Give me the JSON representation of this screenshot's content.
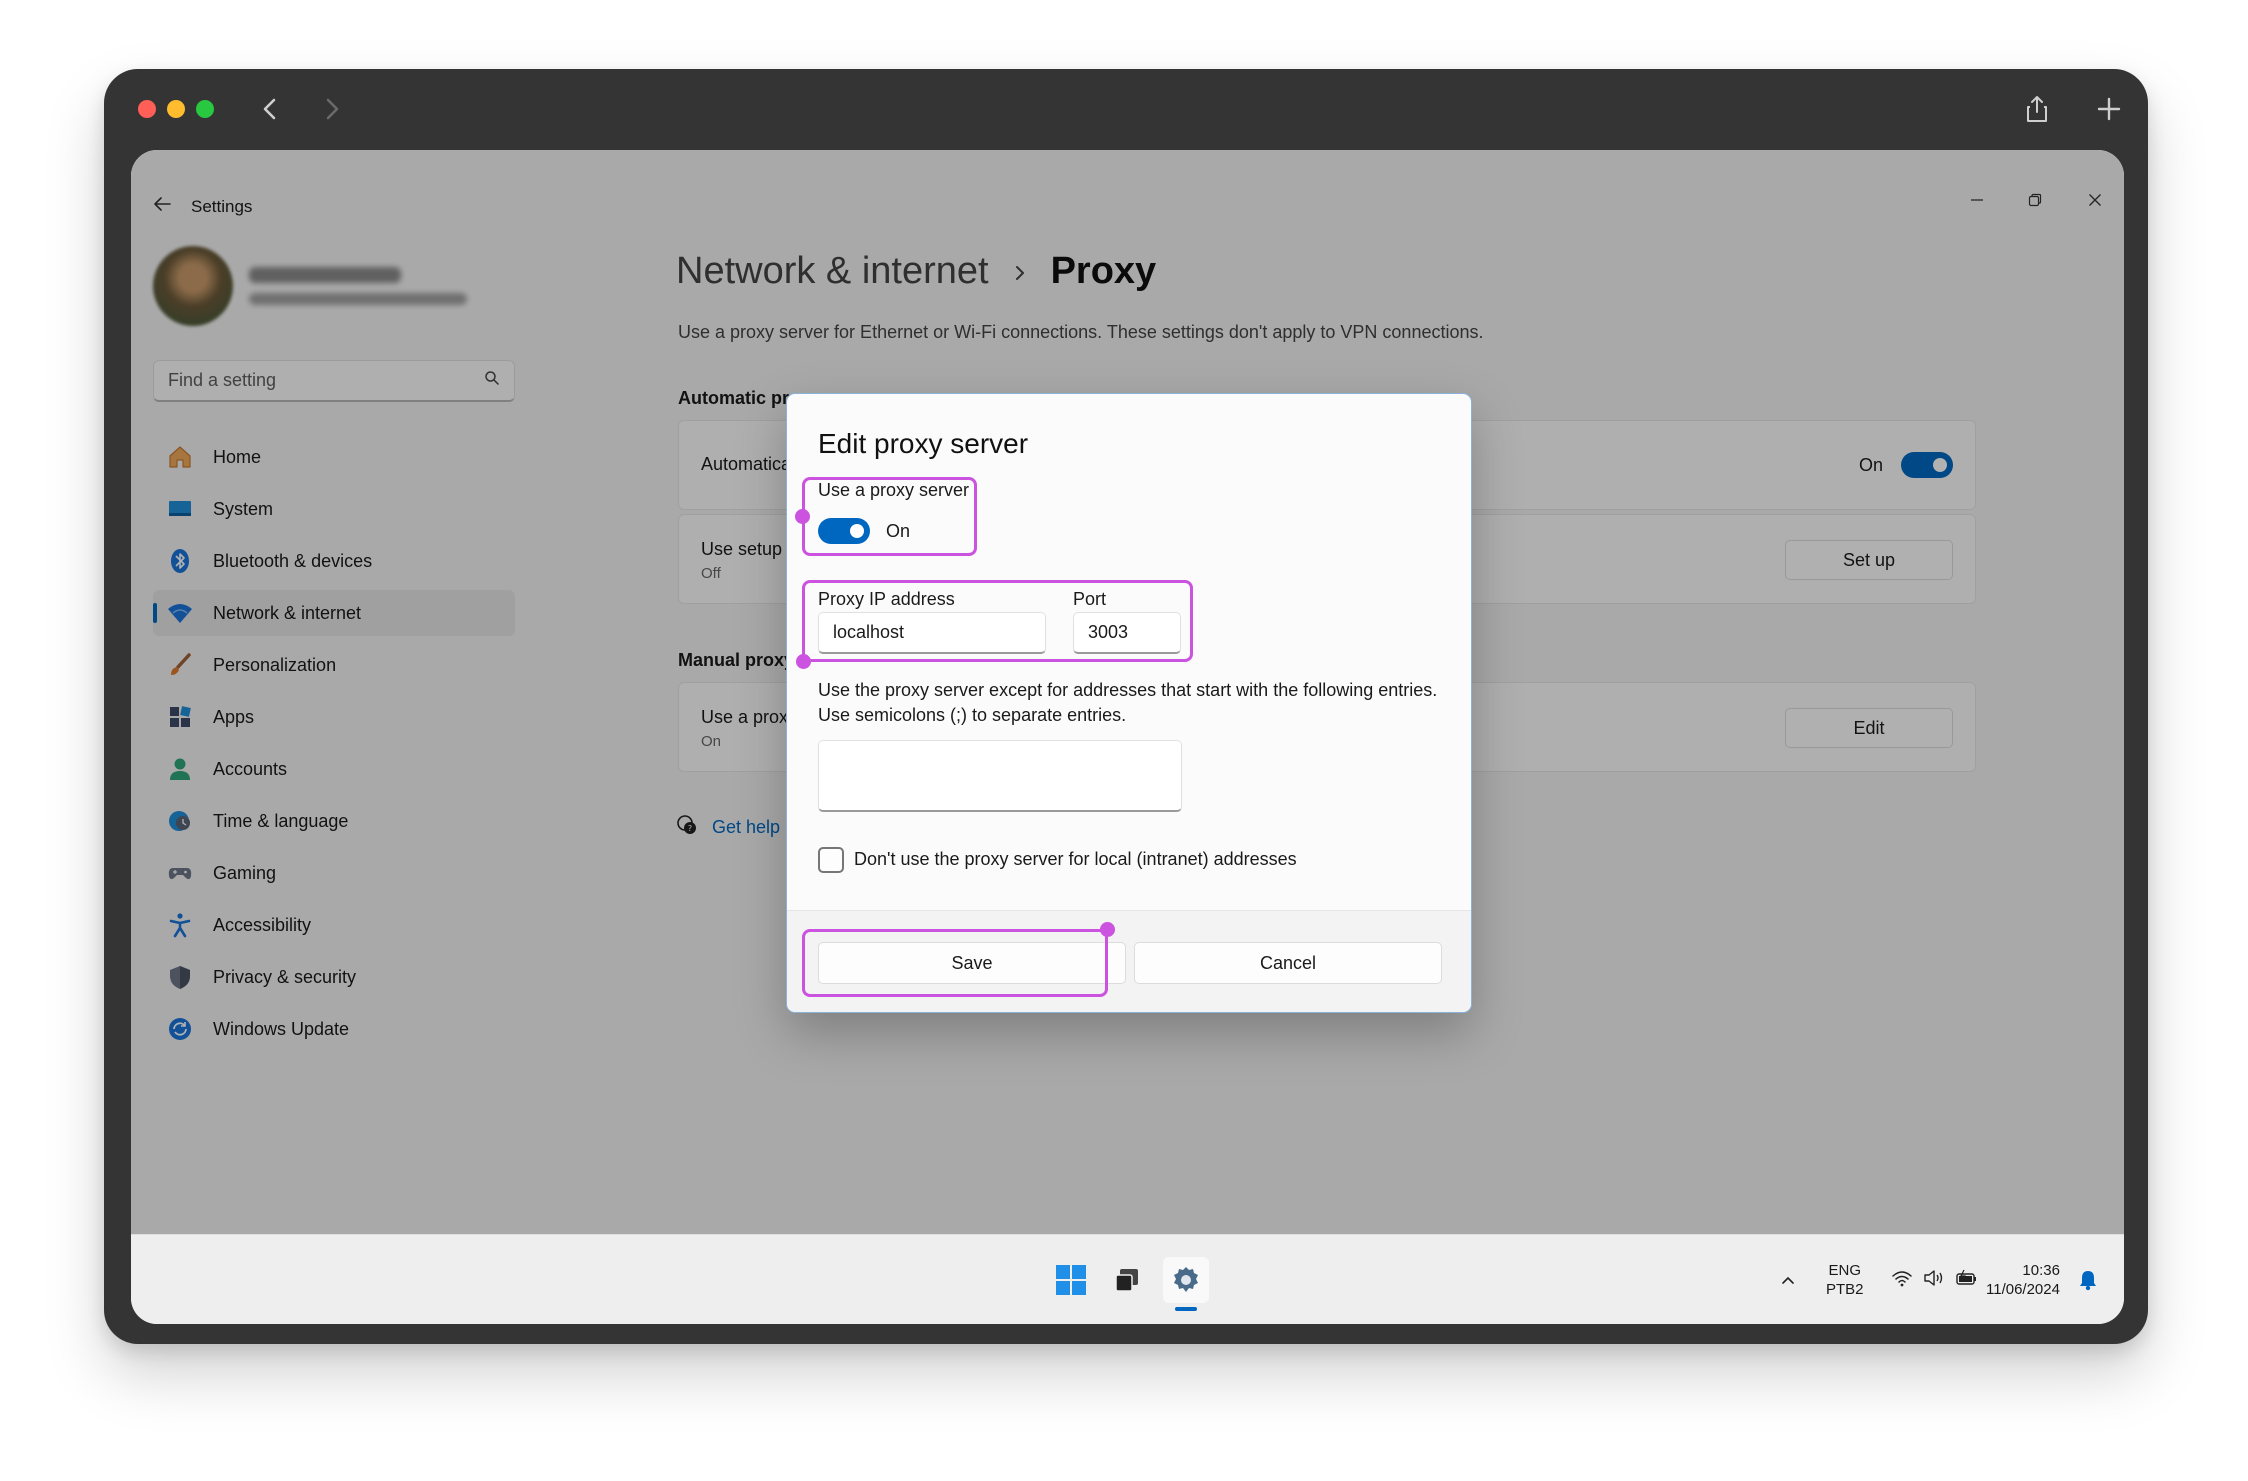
{
  "titlebar": {
    "app_name": "Settings"
  },
  "search": {
    "placeholder": "Find a setting"
  },
  "sidebar": {
    "items": [
      {
        "label": "Home",
        "icon": "home-icon"
      },
      {
        "label": "System",
        "icon": "system-icon"
      },
      {
        "label": "Bluetooth & devices",
        "icon": "bluetooth-icon"
      },
      {
        "label": "Network & internet",
        "icon": "wifi-icon",
        "active": true
      },
      {
        "label": "Personalization",
        "icon": "brush-icon"
      },
      {
        "label": "Apps",
        "icon": "apps-icon"
      },
      {
        "label": "Accounts",
        "icon": "account-icon"
      },
      {
        "label": "Time & language",
        "icon": "globe-clock-icon"
      },
      {
        "label": "Gaming",
        "icon": "gamepad-icon"
      },
      {
        "label": "Accessibility",
        "icon": "accessibility-icon"
      },
      {
        "label": "Privacy & security",
        "icon": "shield-icon"
      },
      {
        "label": "Windows Update",
        "icon": "update-icon"
      }
    ]
  },
  "page": {
    "breadcrumb_parent": "Network & internet",
    "breadcrumb_current": "Proxy",
    "description": "Use a proxy server for Ethernet or Wi-Fi connections. These settings don't apply to VPN connections.",
    "auto_section_title": "Automatic pr",
    "auto_detect_label": "Automatica",
    "auto_detect_state": "On",
    "setup_script_label": "Use setup s",
    "setup_script_state": "Off",
    "setup_button": "Set up",
    "manual_section_title": "Manual proxy",
    "use_proxy_label": "Use a prox",
    "use_proxy_state": "On",
    "edit_button": "Edit",
    "help_link": "Get help"
  },
  "dialog": {
    "title": "Edit proxy server",
    "use_proxy_label": "Use a proxy server",
    "use_proxy_state": "On",
    "ip_label": "Proxy IP address",
    "ip_value": "localhost",
    "port_label": "Port",
    "port_value": "3003",
    "exceptions_line1": "Use the proxy server except for addresses that start with the following entries.",
    "exceptions_line2": "Use semicolons (;) to separate entries.",
    "exceptions_value": "",
    "local_checkbox_label": "Don't use the proxy server for local (intranet) addresses",
    "local_checkbox_checked": false,
    "save_button": "Save",
    "cancel_button": "Cancel"
  },
  "taskbar": {
    "language": "ENG",
    "layout": "PTB2",
    "time": "10:36",
    "date": "11/06/2024"
  },
  "colors": {
    "accent": "#0067c0",
    "highlight": "#cc52e0",
    "frame": "#343434"
  }
}
